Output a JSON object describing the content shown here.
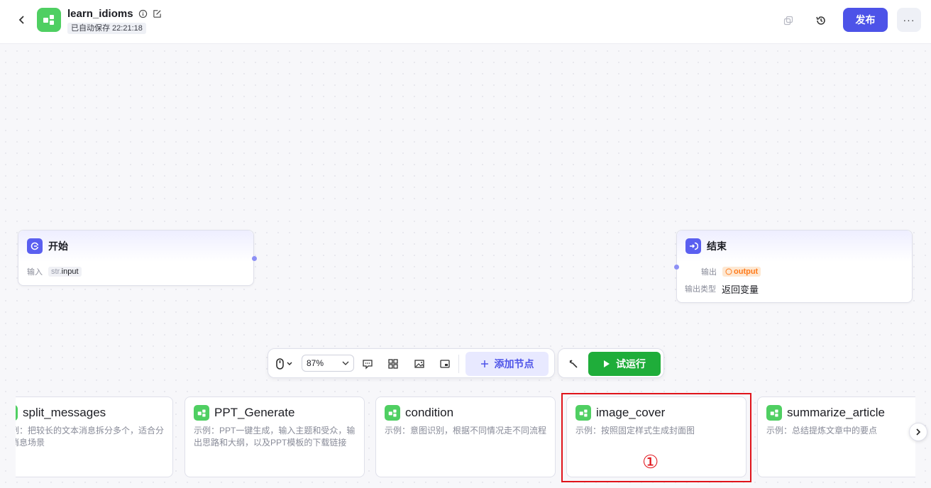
{
  "header": {
    "title": "learn_idioms",
    "autosave": "已自动保存 22:21:18",
    "publish_label": "发布",
    "more_label": "···"
  },
  "start_node": {
    "title": "开始",
    "input_label": "输入",
    "input_type": "str.",
    "input_name": "input"
  },
  "end_node": {
    "title": "结束",
    "output_label": "输出",
    "output_name": "output",
    "output_type_label": "输出类型",
    "output_type_value": "返回变量"
  },
  "toolbar": {
    "zoom": "87%",
    "add_node_label": "添加节点",
    "trial_run_label": "试运行"
  },
  "cards": [
    {
      "title": "split_messages",
      "desc": "示例：把较长的文本消息拆分多个，适合分发消息场景"
    },
    {
      "title": "PPT_Generate",
      "desc": "示例：PPT一键生成，输入主题和受众，输出思路和大纲，以及PPT模板的下载链接"
    },
    {
      "title": "condition",
      "desc": "示例：意图识别，根据不同情况走不同流程"
    },
    {
      "title": "image_cover",
      "desc": "示例：按照固定样式生成封面图"
    },
    {
      "title": "summarize_article",
      "desc": "示例：总结提炼文章中的要点"
    }
  ],
  "annotation": "①",
  "colors": {
    "accent": "#4d53e8",
    "workflow_green": "#4fcf62",
    "run_green": "#1fad3a",
    "highlight_red": "#e0131a"
  }
}
